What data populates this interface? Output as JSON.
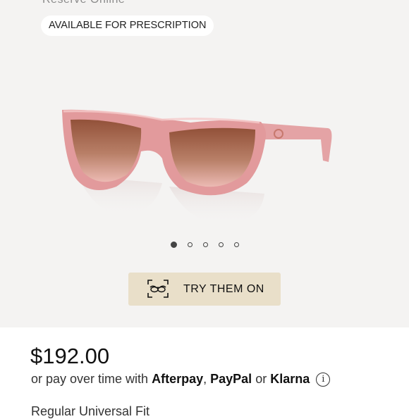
{
  "gallery": {
    "cut_top_text": "Reserve Online",
    "badge": "AVAILABLE FOR PRESCRIPTION",
    "image_alt": "pink cat-eye sunglasses",
    "dots_total": 5,
    "dots_active": 1,
    "colors": {
      "frame": "#e29a9c",
      "lens_top": "#9c5c45",
      "lens_bottom": "#e7b3ad"
    }
  },
  "try_on": {
    "icon": "glasses-scan-icon",
    "label": "TRY THEM ON"
  },
  "price": "$192.00",
  "payment": {
    "prefix": "or pay over time with",
    "provider1": "Afterpay",
    "sep1": ",",
    "provider2": "PayPal",
    "sep2": "or",
    "provider3": "Klarna",
    "info_icon": "i"
  },
  "cut_bottom_text": "Regular  Universal Fit"
}
